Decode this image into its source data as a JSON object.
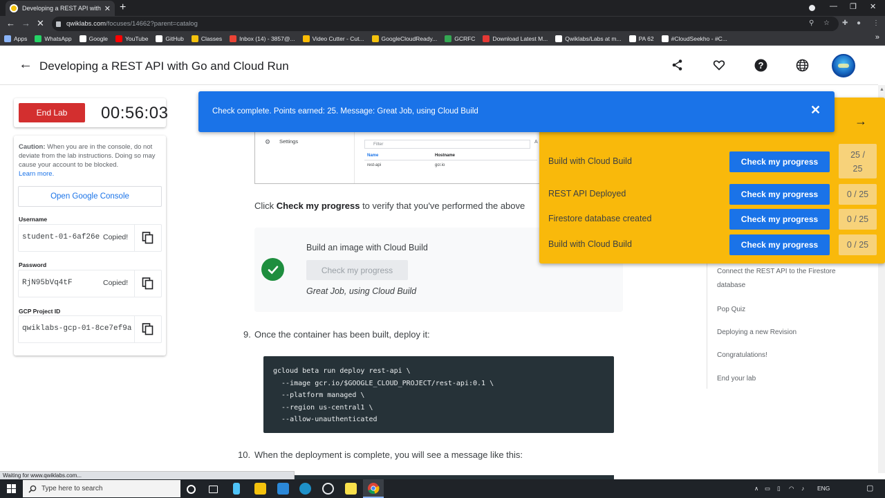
{
  "browser": {
    "tab_title": "Developing a REST API with Go a",
    "tab_close": "✕",
    "new_tab": "+",
    "url_host": "qwiklabs.com",
    "url_path": "/focuses/14662?parent=catalog",
    "bookmarks": [
      {
        "label": "Apps",
        "icon": "apps-icon",
        "color": "#8ab4f8"
      },
      {
        "label": "WhatsApp",
        "icon": "whatsapp-icon",
        "color": "#25d366"
      },
      {
        "label": "Google",
        "icon": "google-icon",
        "color": "#ffffff"
      },
      {
        "label": "YouTube",
        "icon": "youtube-icon",
        "color": "#ff0000"
      },
      {
        "label": "GitHub",
        "icon": "github-icon",
        "color": "#ffffff"
      },
      {
        "label": "Classes",
        "icon": "classroom-icon",
        "color": "#f4c20d"
      },
      {
        "label": "Inbox (14) - 3857@...",
        "icon": "gmail-icon",
        "color": "#ea4335"
      },
      {
        "label": "Video Cutter - Cut...",
        "icon": "video-cutter-icon",
        "color": "#fbbc05"
      },
      {
        "label": "GoogleCloudReady...",
        "icon": "folder-icon",
        "color": "#f4c20d"
      },
      {
        "label": "GCRFC",
        "icon": "gcrfc-icon",
        "color": "#34a853"
      },
      {
        "label": "Download Latest M...",
        "icon": "download-icon",
        "color": "#e53935"
      },
      {
        "label": "Qwiklabs/Labs at m...",
        "icon": "github-icon",
        "color": "#ffffff"
      },
      {
        "label": "PA 62",
        "icon": "pa-icon",
        "color": "#ffffff"
      },
      {
        "label": "#CloudSeekho - #C...",
        "icon": "cloudseekho-icon",
        "color": "#ffffff"
      }
    ],
    "status_text": "Waiting for www.qwiklabs.com..."
  },
  "header": {
    "back": "←",
    "title": "Developing a REST API with Go and Cloud Run"
  },
  "lab": {
    "end_label": "End Lab",
    "timer": "00:56:03",
    "caution_bold": "Caution:",
    "caution_text": " When you are in the console, do not deviate from the lab instructions. Doing so may cause your account to be blocked.",
    "learn_more": "Learn more.",
    "open_console": "Open Google Console",
    "username_label": "Username",
    "username": "student-01-6af26e",
    "password_label": "Password",
    "password": "RjN95bVq4tF",
    "project_label": "GCP Project ID",
    "project_id": "qwiklabs-gcp-01-8ce7ef9a",
    "copied": "Copied!"
  },
  "screenshot": {
    "settings": "Settings",
    "filter": "Filter",
    "col_name": "Name",
    "col_host": "Hostname",
    "row_name": "rest-api",
    "row_host": "gcr.io"
  },
  "content": {
    "para_pre": "Click ",
    "para_bold": "Check my progress",
    "para_post": " to verify that you've performed the above",
    "check_title": "Build an image with Cloud Build",
    "check_button": "Check my progress",
    "check_msg": "Great Job, using Cloud Build",
    "step9_num": "9.",
    "step9": "Once the container has been built, deploy it:",
    "code_lines": [
      "gcloud beta run deploy rest-api \\",
      "  --image gcr.io/$GOOGLE_CLOUD_PROJECT/rest-api:0.1 \\",
      "  --platform managed \\",
      "  --region us-central1 \\",
      "  --allow-unauthenticated"
    ],
    "step10_num": "10.",
    "step10": "When the deployment is complete, you will see a message like this:"
  },
  "toc": [
    "Connect the REST API to the Firestore database",
    "Pop Quiz",
    "Deploying a new Revision",
    "Congratulations!",
    "End your lab"
  ],
  "score": {
    "arrow": "→",
    "objectives": [
      {
        "label": "Build with Cloud Build",
        "button": "Check my progress",
        "score_line1": "25 /",
        "score_line2": "25"
      },
      {
        "label": "REST API Deployed",
        "button": "Check my progress",
        "score_line1": "0 / 25",
        "score_line2": ""
      },
      {
        "label": "Firestore database created",
        "button": "Check my progress",
        "score_line1": "0 / 25",
        "score_line2": ""
      },
      {
        "label": "Build with Cloud Build",
        "button": "Check my progress",
        "score_line1": "0 / 25",
        "score_line2": ""
      }
    ]
  },
  "toast": {
    "message": "Check complete. Points earned: 25. Message: Great Job, using Cloud Build",
    "close": "✕"
  },
  "taskbar": {
    "search_placeholder": "Type here to search",
    "lang": "ENG"
  },
  "colors": {
    "accent_blue": "#1a73e8",
    "score_yellow": "#f9b90b",
    "end_red": "#d32f2f",
    "success_green": "#1e8e3e"
  }
}
